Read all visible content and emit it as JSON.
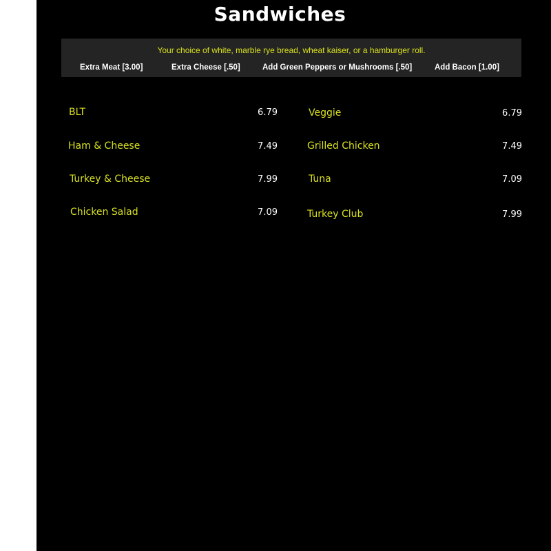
{
  "menu": {
    "title": "Sandwiches",
    "bread_note": "Your choice of white, marble rye bread, wheat kaiser, or a hamburger roll.",
    "extras": [
      "Extra Meat [3.00]",
      "Extra Cheese [.50]",
      "Add Green Peppers or Mushrooms [.50]",
      "Add Bacon [1.00]"
    ],
    "left_items": [
      {
        "name": "BLT",
        "price": "6.79"
      },
      {
        "name": "Ham & Cheese",
        "price": "7.49"
      },
      {
        "name": "Turkey & Cheese",
        "price": "7.99"
      },
      {
        "name": "Chicken Salad",
        "price": "7.09"
      }
    ],
    "right_items": [
      {
        "name": "Veggie",
        "price": "6.79"
      },
      {
        "name": "Grilled Chicken",
        "price": "7.49"
      },
      {
        "name": "Tuna",
        "price": "7.09"
      },
      {
        "name": "Turkey Club",
        "price": "7.99"
      }
    ]
  },
  "colors": {
    "background": "#000000",
    "banner": "#242424",
    "accent": "#d8e020",
    "price_text": "#ffffff"
  }
}
